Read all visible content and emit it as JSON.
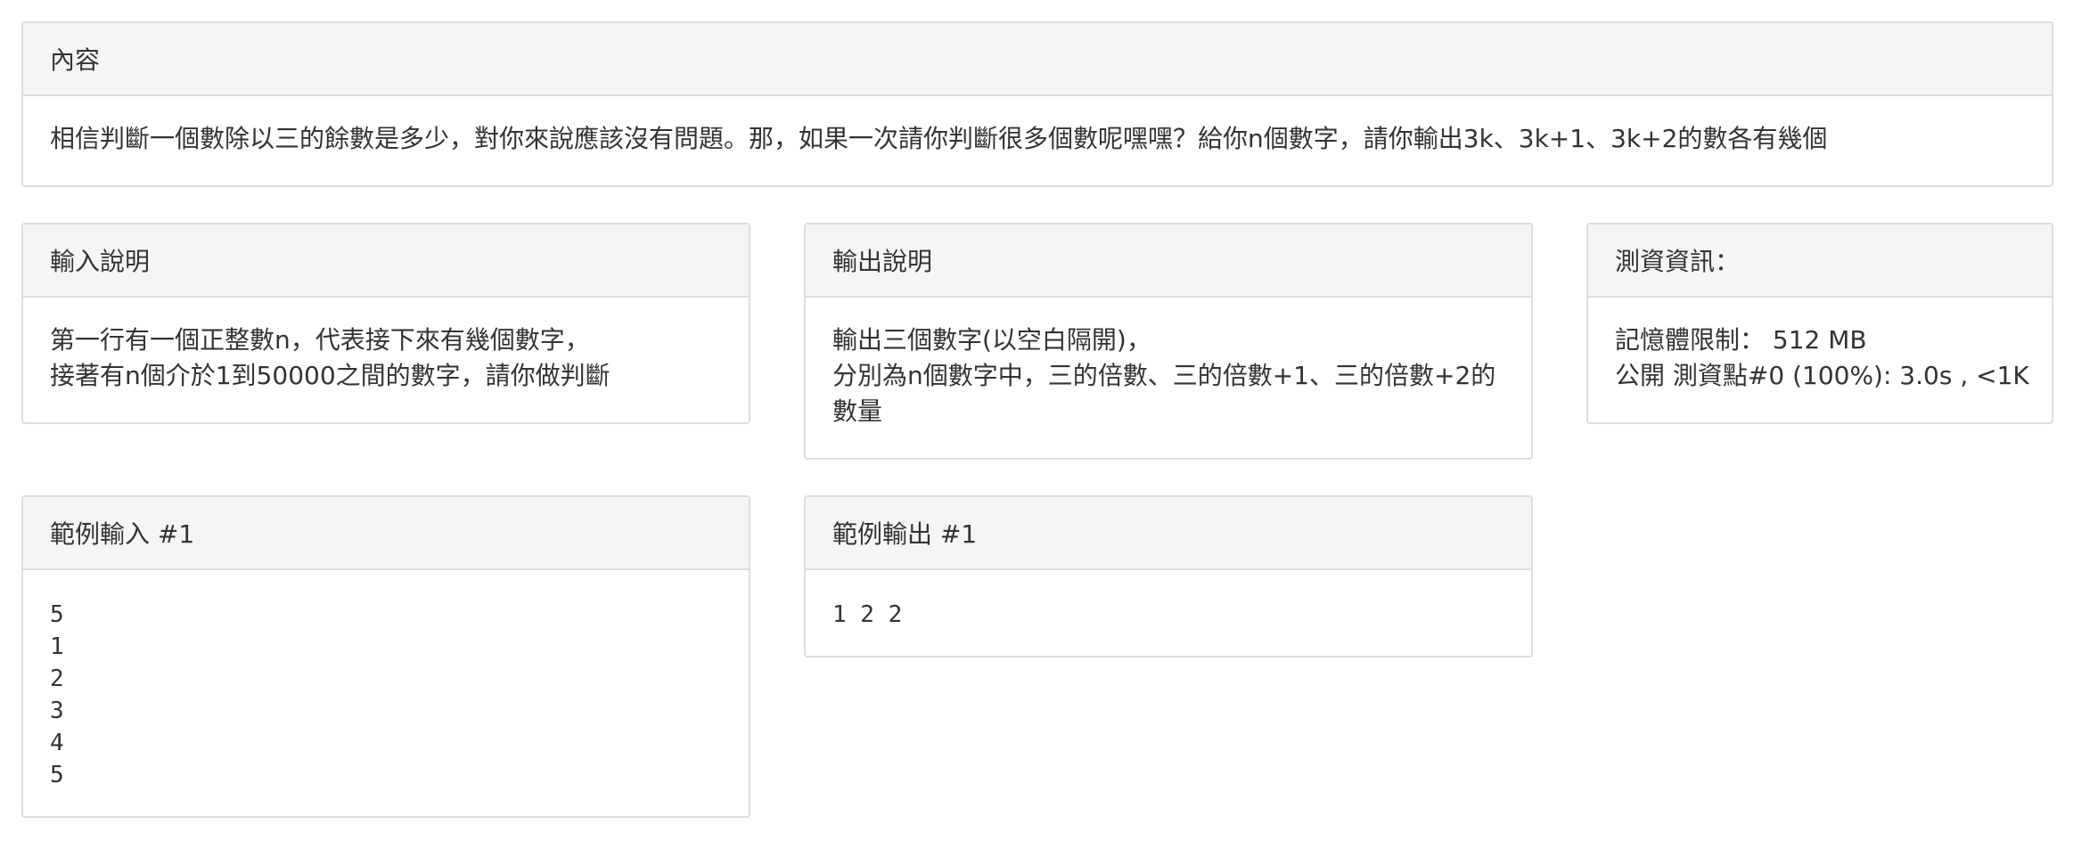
{
  "content": {
    "heading": "內容",
    "text": "相信判斷一個數除以三的餘數是多少，對你來說應該沒有問題。那，如果一次請你判斷很多個數呢嘿嘿？給你n個數字，請你輸出3k、3k+1、3k+2的數各有幾個"
  },
  "input_desc": {
    "heading": "輸入說明",
    "lines": [
      "第一行有一個正整數n，代表接下來有幾個數字，",
      "接著有n個介於1到50000之間的數字，請你做判斷"
    ]
  },
  "output_desc": {
    "heading": "輸出說明",
    "lines": [
      "輸出三個數字(以空白隔開)，",
      "分別為n個數字中，三的倍數、三的倍數+1、三的倍數+2的數量"
    ]
  },
  "test_info": {
    "heading": "測資資訊：",
    "memory": "記憶體限制： 512 MB",
    "testcase": "公開 測資點#0 (100%): 3.0s , <1K"
  },
  "sample_input": {
    "heading": "範例輸入 #1",
    "lines": [
      "5",
      "1",
      "2",
      "3",
      "4",
      "5"
    ]
  },
  "sample_output": {
    "heading": "範例輸出 #1",
    "lines": [
      "1 2 2"
    ]
  }
}
